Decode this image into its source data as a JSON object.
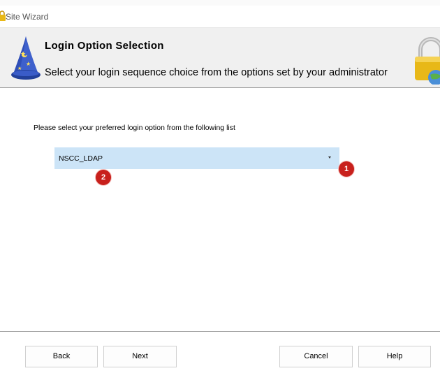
{
  "window": {
    "title": "Site Wizard"
  },
  "header": {
    "title": "Login Option Selection",
    "subtitle": "Select your login sequence choice from the options set by your administrator"
  },
  "main": {
    "instruction": "Please select your preferred  login option from the following list",
    "login_option": {
      "selected": "NSCC_LDAP"
    }
  },
  "annotations": {
    "badge1": "1",
    "badge2": "2"
  },
  "buttons": {
    "back": "Back",
    "next": "Next",
    "cancel": "Cancel",
    "help": "Help"
  },
  "colors": {
    "dropdown_bg": "#cce4f7",
    "badge": "#c8201c",
    "header_bg": "#f0f0f0"
  }
}
